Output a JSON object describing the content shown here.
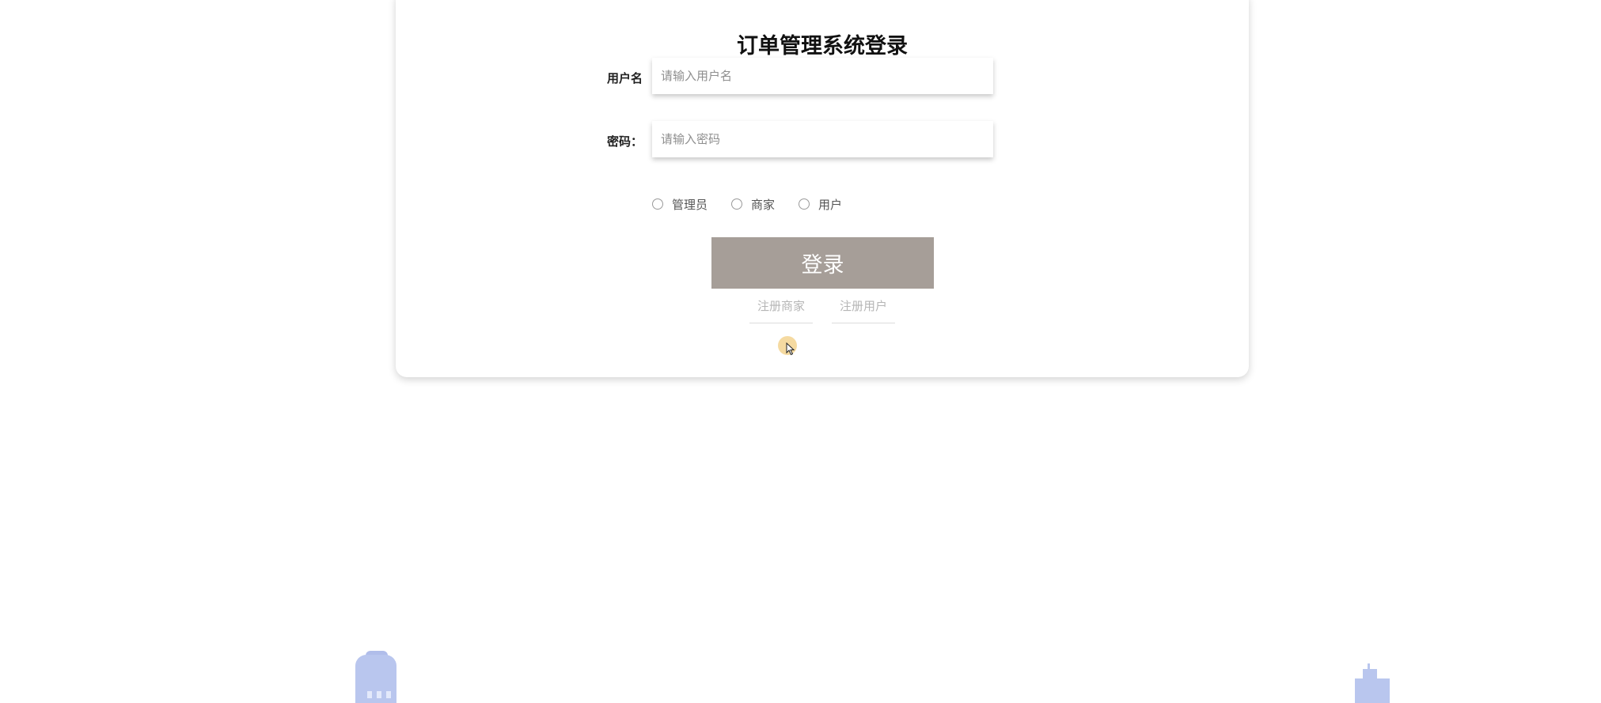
{
  "page": {
    "title": "订单管理系统登录"
  },
  "form": {
    "username_label": "用户名",
    "username_placeholder": "请输入用户名",
    "password_label": "密码：",
    "password_placeholder": "请输入密码",
    "roles": [
      {
        "label": "管理员"
      },
      {
        "label": "商家"
      },
      {
        "label": "用户"
      }
    ],
    "login_label": "登录"
  },
  "links": {
    "register_merchant": "注册商家",
    "register_user": "注册用户"
  },
  "colors": {
    "login_button": "#a69e98",
    "building": "#b9c6ee"
  }
}
